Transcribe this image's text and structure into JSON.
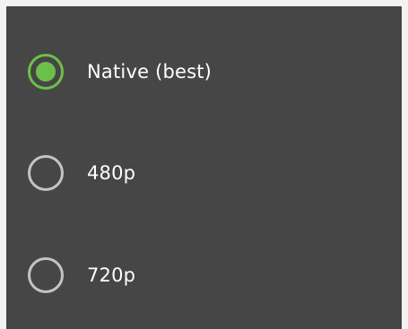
{
  "quality_options": {
    "selected": "Native (best)",
    "items": [
      {
        "label": "Native (best)",
        "checked": true
      },
      {
        "label": "480p",
        "checked": false
      },
      {
        "label": "720p",
        "checked": false
      }
    ]
  },
  "colors": {
    "panel_background": "#464646",
    "accent": "#6cc04a",
    "unselected_ring": "#c4c4c4",
    "text": "#ffffff"
  }
}
